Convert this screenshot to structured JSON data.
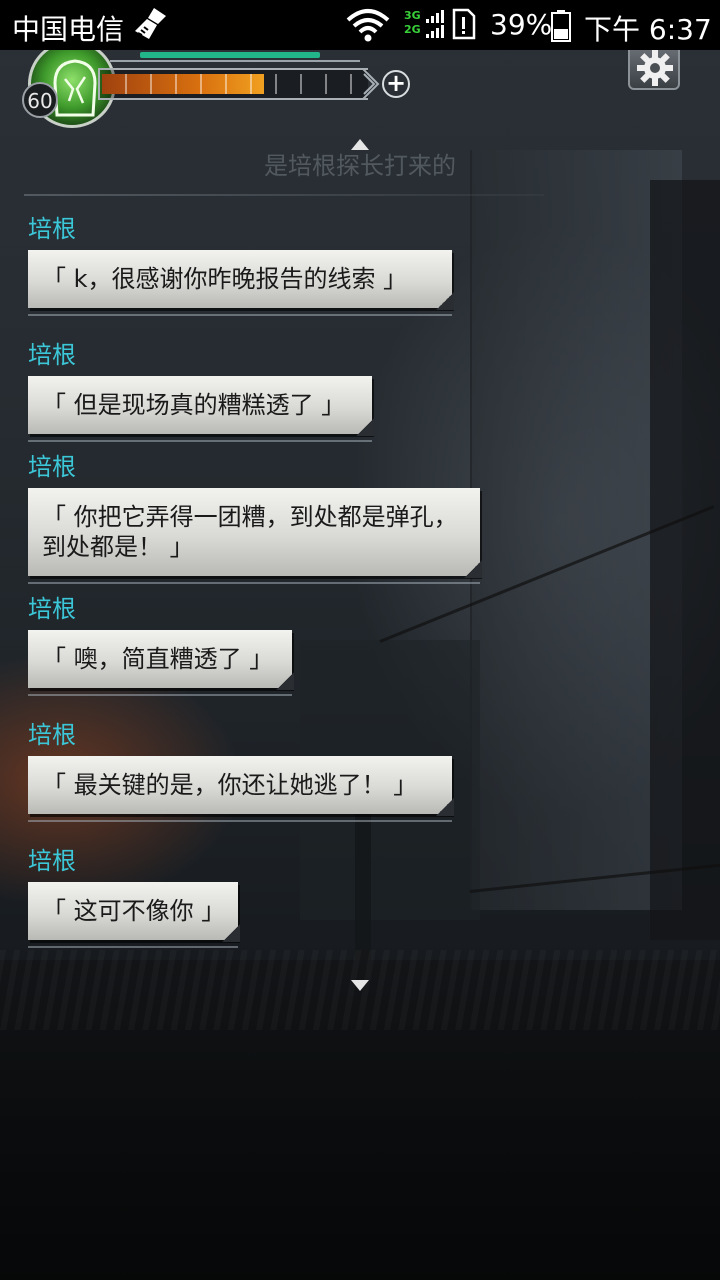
{
  "status_bar": {
    "carrier": "中国电信",
    "network_label_top": "3G",
    "network_label_bottom": "2G",
    "battery_percent": "39%",
    "time": "下午 6:37"
  },
  "hud": {
    "level": "60",
    "xp_fill_fraction": 0.62,
    "plus_symbol": "+"
  },
  "chat": {
    "faded_previous_line": "是培根探长打来的",
    "messages": [
      {
        "speaker": "培根",
        "text": "「 k，很感谢你昨晚报告的线索 」"
      },
      {
        "speaker": "培根",
        "text": "「 但是现场真的糟糕透了 」"
      },
      {
        "speaker": "培根",
        "text": "「 你把它弄得一团糟，到处都是弹孔，到处都是！ 」"
      },
      {
        "speaker": "培根",
        "text": "「 噢，简直糟透了 」"
      },
      {
        "speaker": "培根",
        "text": "「 最关键的是，你还让她逃了！ 」"
      },
      {
        "speaker": "培根",
        "text": "「 这可不像你 」"
      }
    ]
  },
  "colors": {
    "speaker": "#3cc7d8",
    "hp": "#23b58a",
    "xp": "#d8700f"
  },
  "icons": [
    "broom-icon",
    "wifi-icon",
    "sim-icon",
    "battery-icon",
    "avatar-icon",
    "plus-icon",
    "gear-icon",
    "scroll-up-arrow-icon",
    "scroll-down-arrow-icon"
  ]
}
